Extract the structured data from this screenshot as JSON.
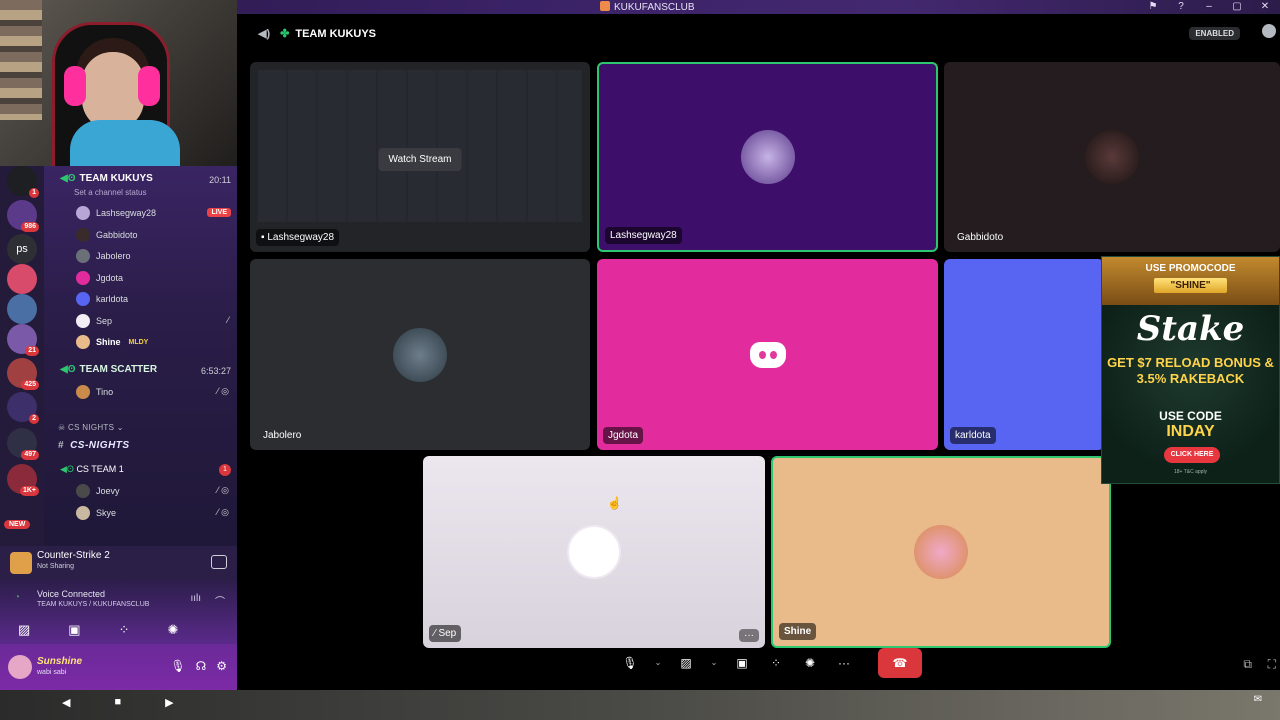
{
  "window": {
    "title": "KUKUFANSCLUB"
  },
  "rail": {
    "items": [
      {
        "label": "",
        "badge": "1"
      },
      {
        "label": "",
        "badge": "986"
      },
      {
        "label": "ps",
        "badge": ""
      },
      {
        "label": "",
        "badge": ""
      },
      {
        "label": "",
        "badge": ""
      },
      {
        "label": "",
        "badge": "21"
      },
      {
        "label": "",
        "badge": "425"
      },
      {
        "label": "",
        "badge": "2"
      },
      {
        "label": "",
        "badge": "497"
      },
      {
        "label": "",
        "badge": "1K+"
      }
    ],
    "new_label": "NEW"
  },
  "channels": {
    "team_kukuys": {
      "name": "TEAM KUKUYS",
      "time": "20:11",
      "status_placeholder": "Set a channel status"
    },
    "members": [
      {
        "name": "Lashsegway28",
        "live": "LIVE"
      },
      {
        "name": "Gabbidoto"
      },
      {
        "name": "Jabolero"
      },
      {
        "name": "Jgdota"
      },
      {
        "name": "karldota"
      },
      {
        "name": "Sep"
      },
      {
        "name": "Shine",
        "tag": "MLDY"
      }
    ],
    "team_scatter": {
      "name": "TEAM SCATTER",
      "time": "6:53:27"
    },
    "scatter_members": [
      {
        "name": "Tino"
      }
    ],
    "category": "CS NIGHTS",
    "text_channel": "CS-NIGHTS",
    "cs_team": {
      "name": "CS TEAM 1",
      "badge": "1"
    },
    "cs_members": [
      {
        "name": "Joevy"
      },
      {
        "name": "Skye"
      }
    ]
  },
  "activity": {
    "game": "Counter-Strike 2",
    "status": "Not Sharing"
  },
  "voice": {
    "status": "Voice Connected",
    "channel": "TEAM KUKUYS / KUKUFANSCLUB"
  },
  "user": {
    "name": "Sunshine",
    "status": "wabi sabi"
  },
  "call": {
    "title": "TEAM KUKUYS",
    "enabled": "ENABLED",
    "watch_stream": "Watch Stream",
    "tiles": [
      {
        "name": "Lashsegway28"
      },
      {
        "name": "Lashsegway28"
      },
      {
        "name": "Gabbidoto"
      },
      {
        "name": "Jabolero"
      },
      {
        "name": "Jgdota"
      },
      {
        "name": "karldota"
      },
      {
        "name": "Sep"
      },
      {
        "name": "Shine"
      }
    ]
  },
  "ad": {
    "promo_line": "USE PROMOCODE",
    "promo_code": "\"SHINE\"",
    "brand": "Stake",
    "offer": "GET $7 RELOAD BONUS & 3.5% RAKEBACK",
    "use_code": "USE CODE",
    "code": "INDAY",
    "cta": "CLICK HERE",
    "fine": "18+ T&C apply"
  },
  "colors": {
    "speaking_green": "#2dc770",
    "tile_purple": "#3d0f6b",
    "tile_pink": "#e22c9e",
    "tile_blurple": "#5865f2",
    "tile_peach": "#e9bb8b",
    "hangup_red": "#da373c"
  }
}
